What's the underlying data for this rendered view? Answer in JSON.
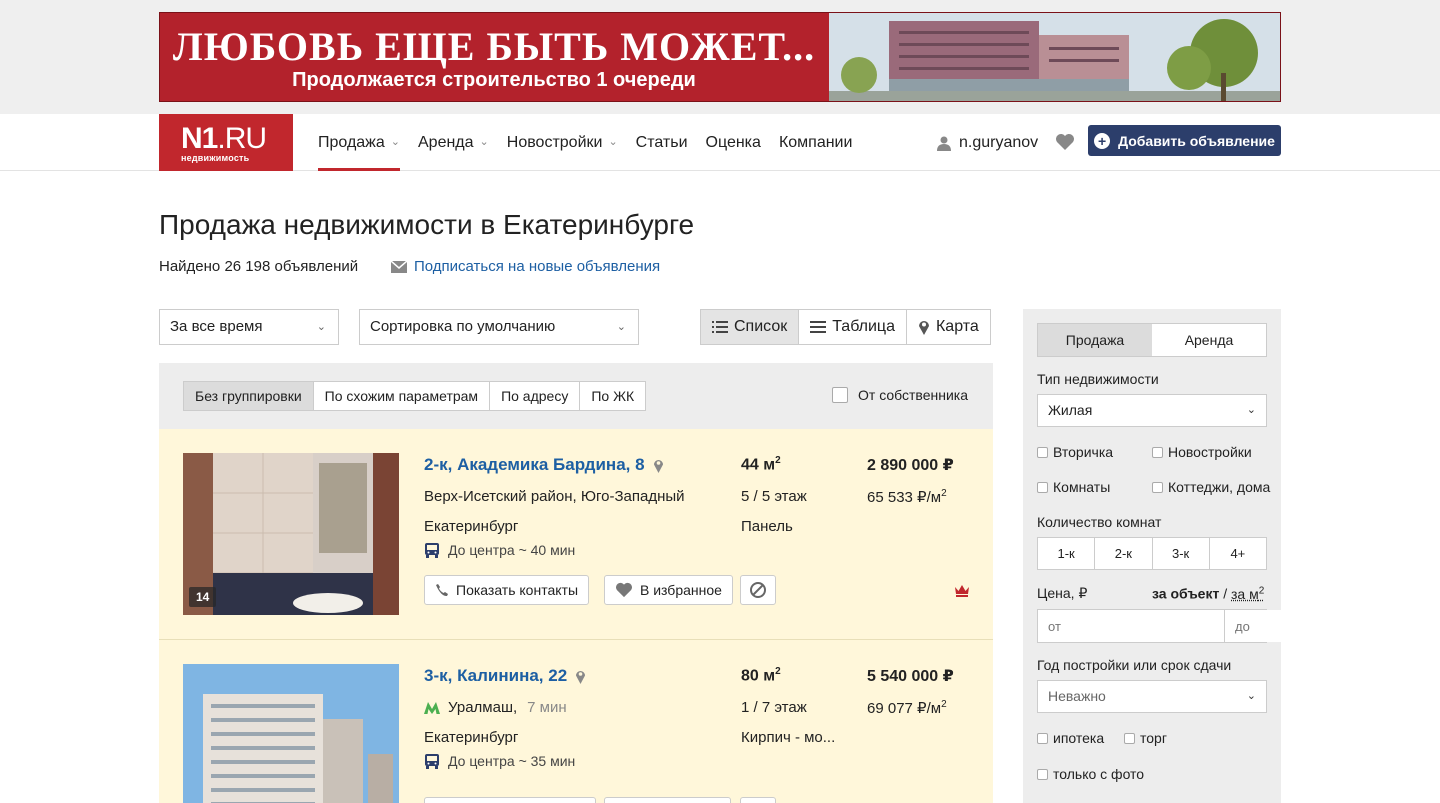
{
  "banner": {
    "headline": "ЛЮБОВЬ ЕЩЕ БЫТЬ МОЖЕТ...",
    "subline": "Продолжается строительство 1 очереди"
  },
  "header": {
    "logo_main": "N1",
    "logo_suffix": ".RU",
    "logo_sub": "недвижимость",
    "nav": [
      {
        "label": "Продажа",
        "has_dropdown": true,
        "active": true
      },
      {
        "label": "Аренда",
        "has_dropdown": true
      },
      {
        "label": "Новостройки",
        "has_dropdown": true
      },
      {
        "label": "Статьи"
      },
      {
        "label": "Оценка"
      },
      {
        "label": "Компании"
      }
    ],
    "username": "n.guryanov",
    "add_button": "Добавить объявление"
  },
  "page": {
    "title": "Продажа недвижимости в Екатеринбурге",
    "found": "Найдено 26 198 объявлений",
    "subscribe": "Подписаться на новые объявления"
  },
  "controls": {
    "period": "За все время",
    "sort": "Сортировка по умолчанию",
    "views": [
      "Список",
      "Таблица",
      "Карта"
    ],
    "active_view": "Список"
  },
  "grouping": {
    "options": [
      "Без группировки",
      "По схожим параметрам",
      "По адресу",
      "По ЖК"
    ],
    "active": "Без группировки",
    "owner_label": "От собственника"
  },
  "listings": [
    {
      "title": "2-к, Академика Бардина, 8",
      "district": "Верх-Исетский район, Юго-Западный",
      "city": "Екатеринбург",
      "commute": "До центра ~ 40 мин",
      "area": "44 м",
      "floor": "5 / 5 этаж",
      "material": "Панель",
      "price": "2 890 000 ₽",
      "price_per_m": "65 533 ₽/м",
      "photo_count": "14",
      "actions": {
        "contacts": "Показать контакты",
        "favorite": "В избранное"
      }
    },
    {
      "title": "3-к, Калинина, 22",
      "metro": "Уралмаш,",
      "metro_time": "7 мин",
      "city": "Екатеринбург",
      "commute": "До центра ~ 35 мин",
      "area": "80 м",
      "floor": "1 / 7 этаж",
      "material": "Кирпич - мо...",
      "price": "5 540 000 ₽",
      "price_per_m": "69 077 ₽/м"
    }
  ],
  "sidebar": {
    "tabs": [
      "Продажа",
      "Аренда"
    ],
    "active_tab": "Продажа",
    "type_label": "Тип недвижимости",
    "type_value": "Жилая",
    "checkboxes_row1": [
      "Вторичка",
      "Новостройки"
    ],
    "checkboxes_row2": [
      "Комнаты",
      "Коттеджи, дома"
    ],
    "rooms_label": "Количество комнат",
    "rooms": [
      "1-к",
      "2-к",
      "3-к",
      "4+"
    ],
    "price_label": "Цена, ₽",
    "price_mode_object": "за объект",
    "price_mode_sep": "/",
    "price_mode_m2": "за м",
    "price_from": "от",
    "price_to": "до",
    "year_label": "Год постройки или срок сдачи",
    "year_value": "Неважно",
    "mortgage": "ипотека",
    "bargain": "торг",
    "photo_only": "только с фото"
  }
}
